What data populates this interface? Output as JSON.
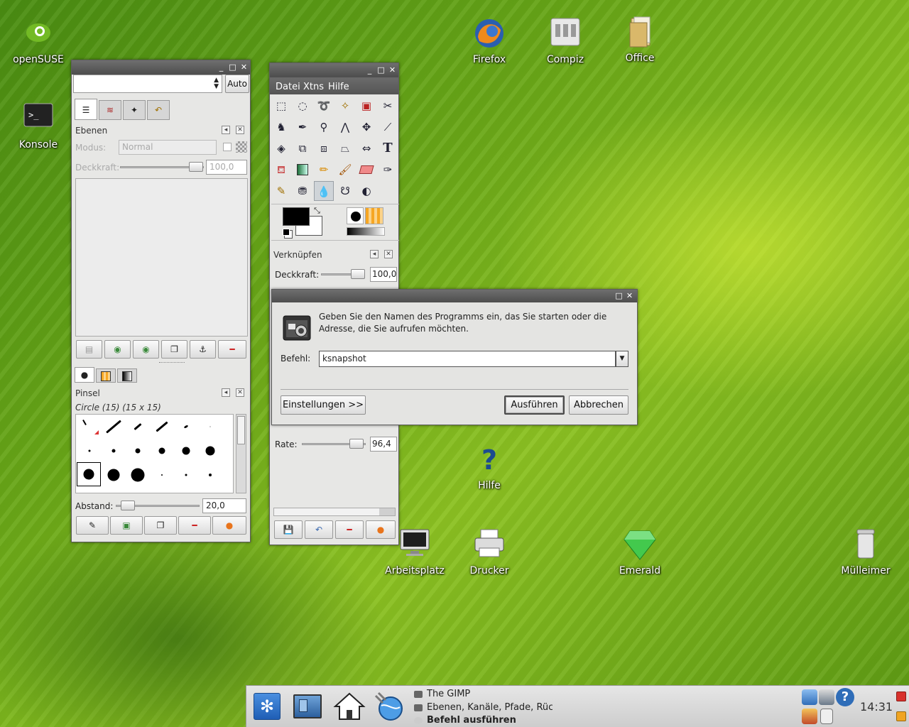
{
  "desktop_icons": [
    {
      "name": "opensuse",
      "label": "openSUSE",
      "icon": "opensuse-logo-icon"
    },
    {
      "name": "konsole",
      "label": "Konsole",
      "icon": "terminal-icon"
    },
    {
      "name": "firefox",
      "label": "Firefox",
      "icon": "firefox-icon"
    },
    {
      "name": "compiz",
      "label": "Compiz",
      "icon": "compiz-icon"
    },
    {
      "name": "office",
      "label": "Office",
      "icon": "folder-icon"
    },
    {
      "name": "hilfe",
      "label": "Hilfe",
      "icon": "help-icon"
    },
    {
      "name": "arbeitsplatz",
      "label": "Arbeitsplatz",
      "icon": "monitor-icon"
    },
    {
      "name": "drucker",
      "label": "Drucker",
      "icon": "printer-icon"
    },
    {
      "name": "emerald",
      "label": "Emerald",
      "icon": "gem-icon"
    },
    {
      "name": "muelleimer",
      "label": "Mülleimer",
      "icon": "trash-icon"
    }
  ],
  "layers_window": {
    "combo_value": "",
    "auto_button": "Auto",
    "ebenen_title": "Ebenen",
    "modus_label": "Modus:",
    "modus_value": "Normal",
    "deckkraft_label": "Deckkraft:",
    "deckkraft_value": "100,0",
    "pinsel_title": "Pinsel",
    "brush_name": "Circle (15) (15 x 15)",
    "abstand_label": "Abstand:",
    "abstand_value": "20,0"
  },
  "toolbox_window": {
    "menu": [
      "Datei",
      "Xtns",
      "Hilfe"
    ],
    "verknuepfen_title": "Verknüpfen",
    "deckkraft_label": "Deckkraft:",
    "deckkraft_value": "100,0",
    "rate_label": "Rate:",
    "rate_value": "96,4"
  },
  "run_dialog": {
    "description": "Geben Sie den Namen des Programms ein, das Sie starten oder die Adresse, die Sie aufrufen möchten.",
    "befehl_label": "Befehl:",
    "befehl_value": "ksnapshot",
    "einstellungen_button": "Einstellungen >>",
    "ausfuehren_button": "Ausführen",
    "abbrechen_button": "Abbrechen"
  },
  "taskbar": {
    "tasks": [
      "The GIMP",
      "Ebenen, Kanäle, Pfade, Rückg",
      "Befehl ausführen"
    ],
    "clock": "14:31"
  },
  "colors": {
    "title_bar": "#5a5a5a",
    "kde_blue": "#2a6fc4",
    "gimp_fg": "#000000",
    "gimp_bg": "#ffffff"
  }
}
